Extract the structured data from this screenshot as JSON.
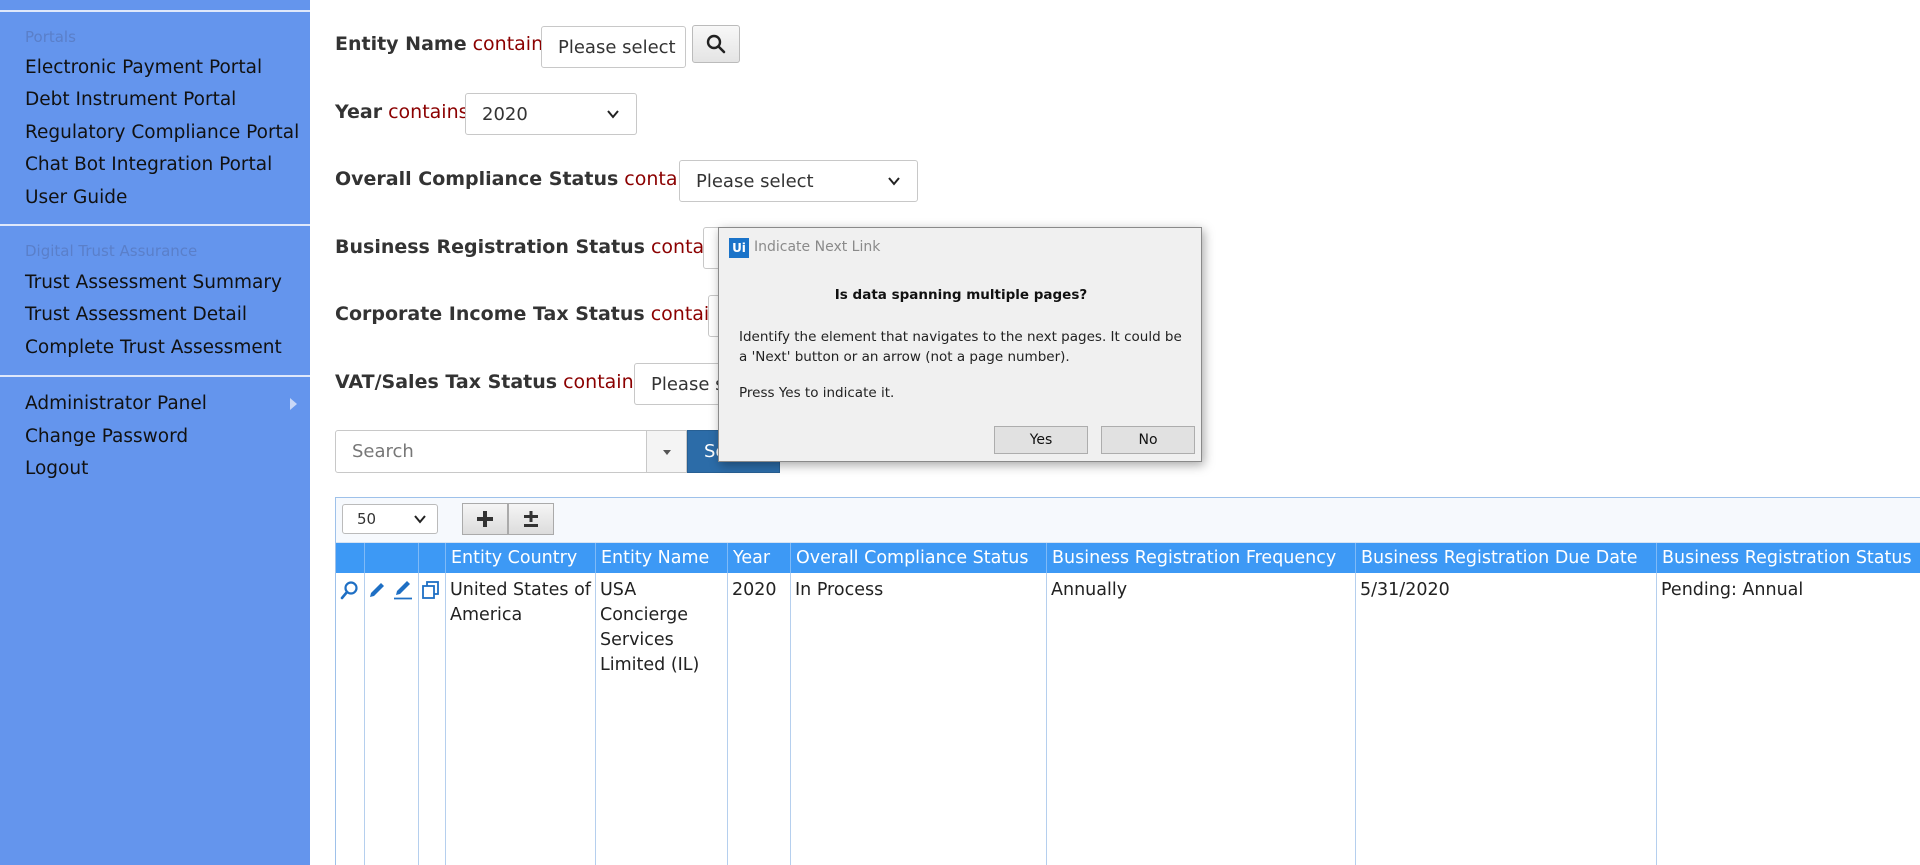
{
  "sidebar": {
    "sections": [
      {
        "header": "Portals",
        "items": [
          "Electronic Payment Portal",
          "Debt Instrument Portal",
          "Regulatory Compliance Portal",
          "Chat Bot Integration Portal",
          "User Guide"
        ]
      },
      {
        "header": "Digital Trust Assurance",
        "items": [
          "Trust Assessment Summary",
          "Trust Assessment Detail",
          "Complete Trust Assessment"
        ]
      },
      {
        "header": "",
        "items": [
          "Administrator Panel",
          "Change Password",
          "Logout"
        ]
      }
    ]
  },
  "filters": [
    {
      "label": "Entity Name",
      "operator": "contains",
      "value": "Please select"
    },
    {
      "label": "Year",
      "operator": "contains",
      "value": "2020"
    },
    {
      "label": "Overall Compliance Status",
      "operator": "contains",
      "value": "Please select"
    },
    {
      "label": "Business Registration Status",
      "operator": "contains",
      "value": ""
    },
    {
      "label": "Corporate Income Tax Status",
      "operator": "contains",
      "value": ""
    },
    {
      "label": "VAT/Sales Tax Status",
      "operator": "contains",
      "value": "Please s"
    }
  ],
  "search": {
    "placeholder": "Search",
    "button_label": "Se"
  },
  "grid": {
    "page_size": "50",
    "columns": [
      "Entity Country",
      "Entity Name",
      "Year",
      "Overall Compliance Status",
      "Business Registration Frequency",
      "Business Registration Due Date",
      "Business Registration Status"
    ],
    "rows": [
      {
        "cells": [
          [
            "United States of",
            "America"
          ],
          [
            "USA",
            "Concierge",
            "Services",
            "Limited (IL)"
          ],
          [
            "2020"
          ],
          [
            "In Process"
          ],
          [
            "Annually"
          ],
          [
            "5/31/2020"
          ],
          [
            "Pending: Annual"
          ]
        ]
      }
    ]
  },
  "dialog": {
    "logo": "Ui",
    "title": "Indicate Next Link",
    "question": "Is data spanning multiple pages?",
    "body": "Identify the element that navigates to the next pages. It could be a 'Next' button or an arrow (not a page number).",
    "body2": "Press Yes to indicate it.",
    "yes_label": "Yes",
    "no_label": "No"
  },
  "colors": {
    "sidebar": "#6495ed",
    "grid_header": "#3d99f5",
    "operator": "#8b0000",
    "search_button": "#2c6ca8"
  }
}
